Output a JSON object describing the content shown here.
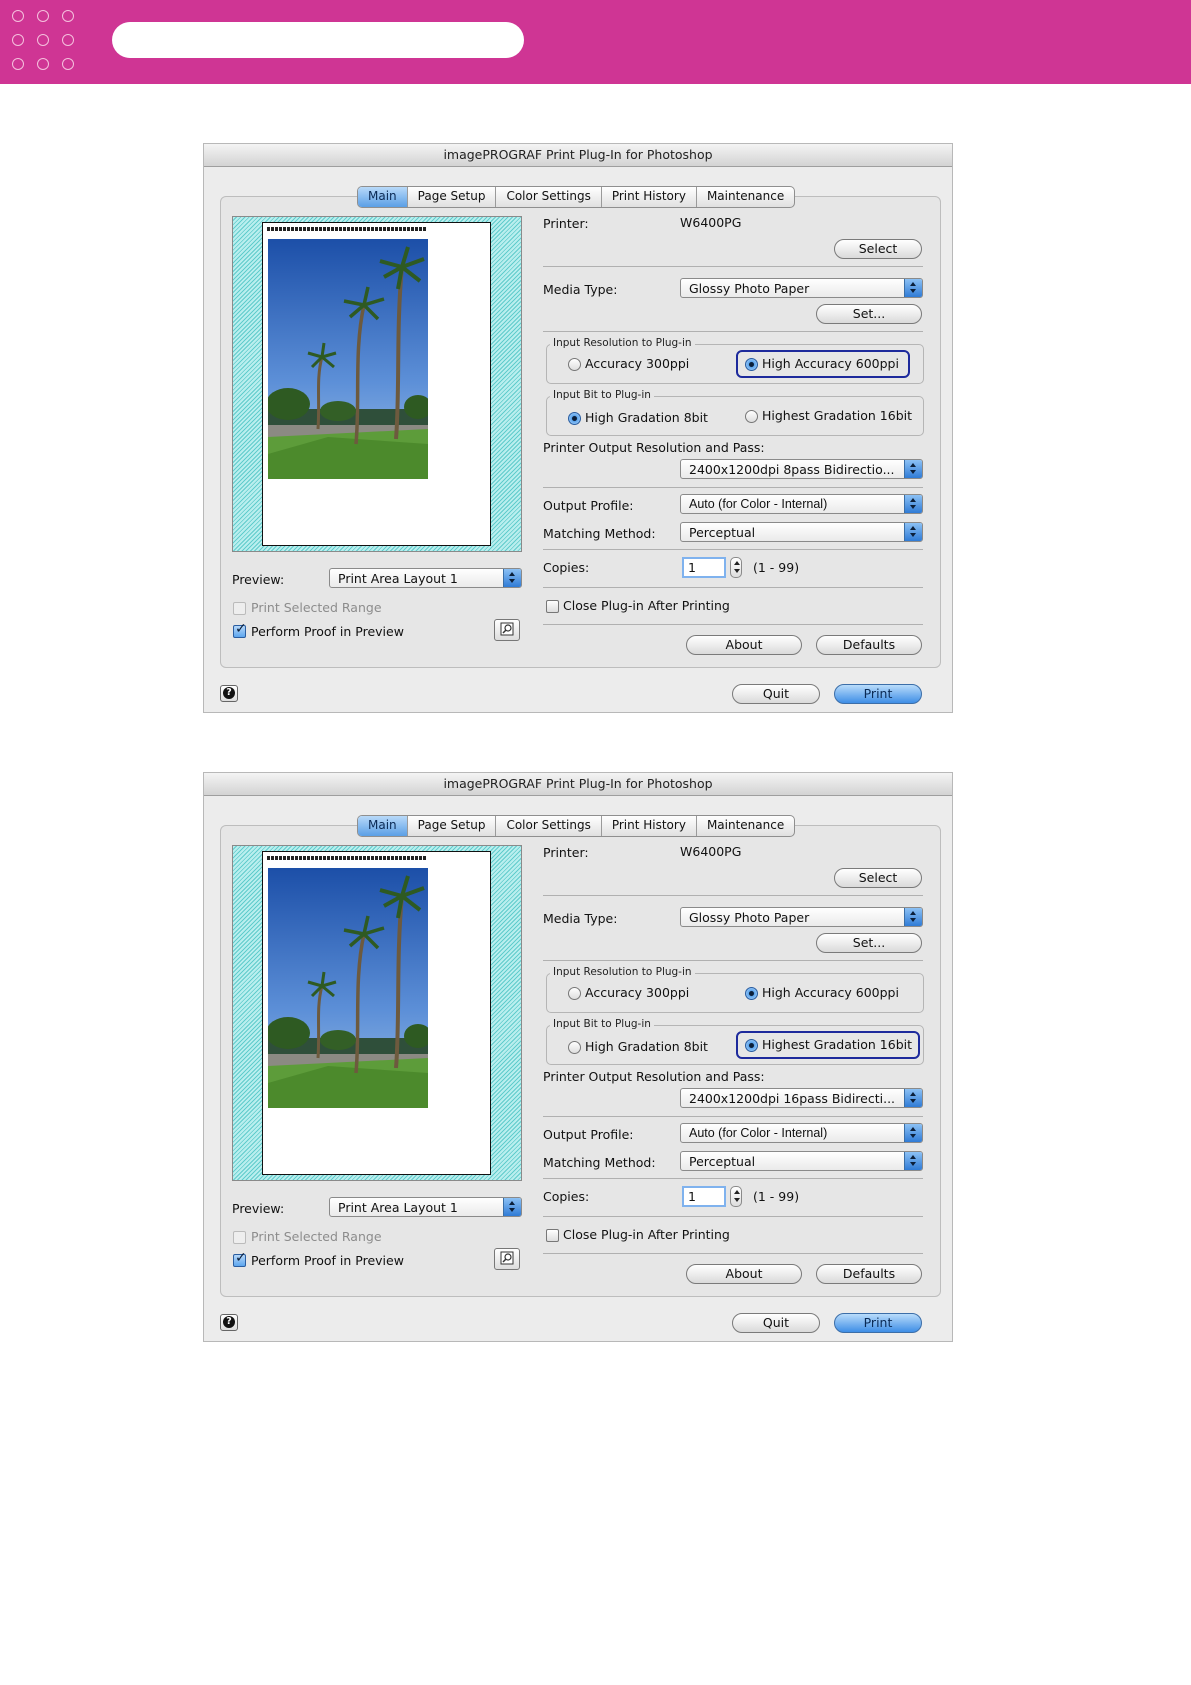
{
  "dialogs": [
    {
      "title": "imagePROGRAF Print Plug-In for Photoshop",
      "tabs": [
        {
          "label": "Main",
          "active": true
        },
        {
          "label": "Page Setup",
          "active": false
        },
        {
          "label": "Color Settings",
          "active": false
        },
        {
          "label": "Print History",
          "active": false
        },
        {
          "label": "Maintenance",
          "active": false
        }
      ],
      "printer_label": "Printer:",
      "printer_value": "W6400PG",
      "select_button": "Select",
      "media_type_label": "Media Type:",
      "media_type_value": "Glossy Photo Paper",
      "set_button": "Set...",
      "input_resolution_group": "Input Resolution to Plug-in",
      "resolution_option_1": "Accuracy 300ppi",
      "resolution_option_2": "High Accuracy 600ppi",
      "resolution_selected": 2,
      "input_bit_group": "Input Bit to Plug-in",
      "bit_option_1": "High Gradation 8bit",
      "bit_option_2": "Highest Gradation 16bit",
      "bit_selected": 1,
      "highlight": "resolution",
      "output_resolution_label": "Printer Output Resolution and Pass:",
      "output_resolution_value": "2400x1200dpi 8pass Bidirectio...",
      "output_profile_label": "Output Profile:",
      "output_profile_value": "Auto (for Color - Internal)",
      "matching_method_label": "Matching Method:",
      "matching_method_value": "Perceptual",
      "copies_label": "Copies:",
      "copies_value": "1",
      "copies_range": "(1 - 99)",
      "close_after_printing": "Close Plug-in After Printing",
      "close_after_printing_checked": false,
      "about_button": "About",
      "defaults_button": "Defaults",
      "preview_label": "Preview:",
      "preview_value": "Print Area Layout 1",
      "print_selected_range": "Print Selected Range",
      "print_selected_range_enabled": false,
      "perform_proof": "Perform Proof in Preview",
      "perform_proof_checked": true,
      "quit_button": "Quit",
      "print_button": "Print",
      "help_icon": "question-mark-icon",
      "proof_icon": "proof-preview-icon"
    },
    {
      "title": "imagePROGRAF Print Plug-In for Photoshop",
      "tabs": [
        {
          "label": "Main",
          "active": true
        },
        {
          "label": "Page Setup",
          "active": false
        },
        {
          "label": "Color Settings",
          "active": false
        },
        {
          "label": "Print History",
          "active": false
        },
        {
          "label": "Maintenance",
          "active": false
        }
      ],
      "printer_label": "Printer:",
      "printer_value": "W6400PG",
      "select_button": "Select",
      "media_type_label": "Media Type:",
      "media_type_value": "Glossy Photo Paper",
      "set_button": "Set...",
      "input_resolution_group": "Input Resolution to Plug-in",
      "resolution_option_1": "Accuracy 300ppi",
      "resolution_option_2": "High Accuracy 600ppi",
      "resolution_selected": 2,
      "input_bit_group": "Input Bit to Plug-in",
      "bit_option_1": "High Gradation 8bit",
      "bit_option_2": "Highest Gradation 16bit",
      "bit_selected": 2,
      "highlight": "bit",
      "output_resolution_label": "Printer Output Resolution and Pass:",
      "output_resolution_value": "2400x1200dpi 16pass Bidirecti...",
      "output_profile_label": "Output Profile:",
      "output_profile_value": "Auto (for Color - Internal)",
      "matching_method_label": "Matching Method:",
      "matching_method_value": "Perceptual",
      "copies_label": "Copies:",
      "copies_value": "1",
      "copies_range": "(1 - 99)",
      "close_after_printing": "Close Plug-in After Printing",
      "close_after_printing_checked": false,
      "about_button": "About",
      "defaults_button": "Defaults",
      "preview_label": "Preview:",
      "preview_value": "Print Area Layout 1",
      "print_selected_range": "Print Selected Range",
      "print_selected_range_enabled": false,
      "perform_proof": "Perform Proof in Preview",
      "perform_proof_checked": true,
      "quit_button": "Quit",
      "print_button": "Print",
      "help_icon": "question-mark-icon",
      "proof_icon": "proof-preview-icon"
    }
  ],
  "colors": {
    "banner": "#cf3594",
    "highlight_border": "#1d2a9c",
    "aqua_blue": "#3e8ee6",
    "preview_hatch": "#60cccc"
  }
}
